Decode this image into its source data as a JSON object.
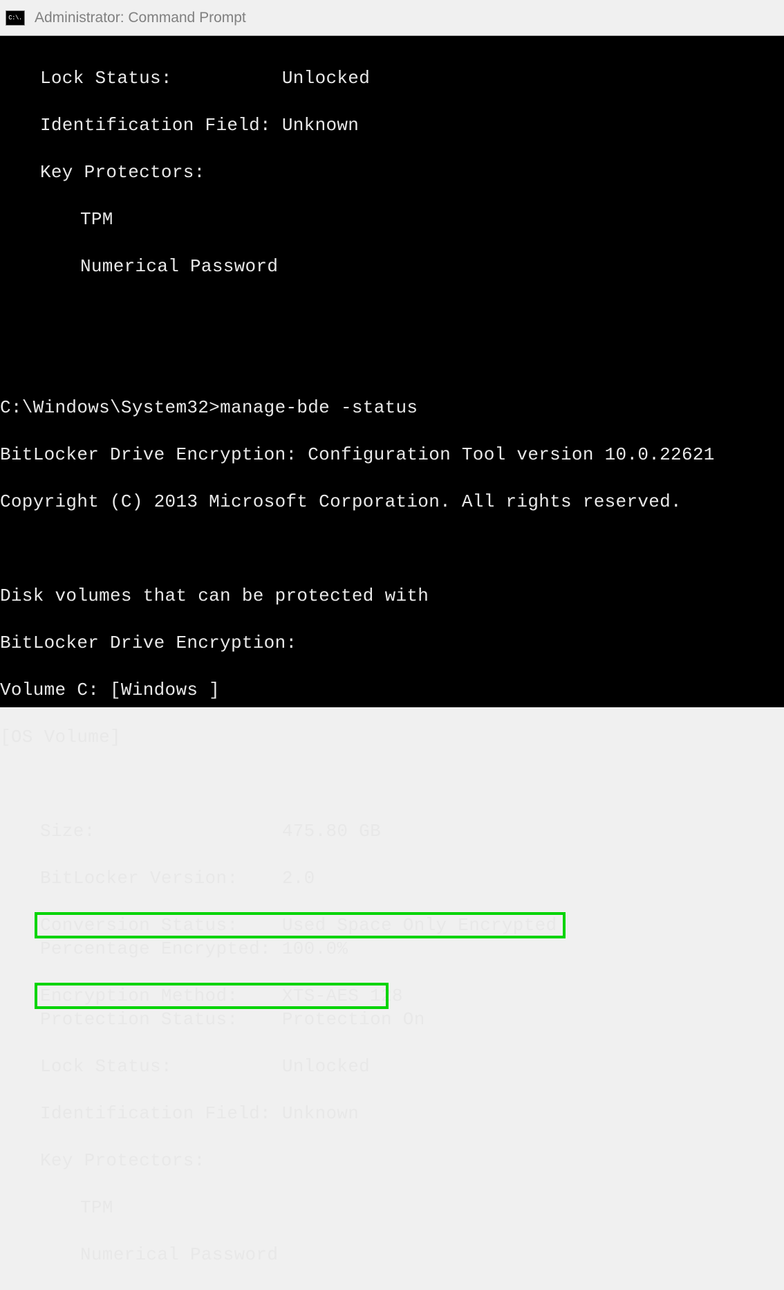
{
  "window": {
    "title": "Administrator: Command Prompt",
    "icon_label": "C:\\."
  },
  "top_block": {
    "lock_status_label": "Lock Status:",
    "lock_status_value": "Unlocked",
    "id_field_label": "Identification Field:",
    "id_field_value": "Unknown",
    "key_protectors_label": "Key Protectors:",
    "kp1": "TPM",
    "kp2": "Numerical Password"
  },
  "cmd": {
    "prompt": "C:\\Windows\\System32>",
    "command": "manage-bde -status",
    "tool_line": "BitLocker Drive Encryption: Configuration Tool version 10.0.22621",
    "copyright": "Copyright (C) 2013 Microsoft Corporation. All rights reserved."
  },
  "section": {
    "heading_l1": "Disk volumes that can be protected with",
    "heading_l2": "BitLocker Drive Encryption:",
    "volume_line": "Volume C: [Windows ]",
    "volume_type": "[OS Volume]"
  },
  "vol": {
    "size_label": "Size:                 ",
    "size_value": "475.80 GB",
    "ver_label": "BitLocker Version:    ",
    "ver_value": "2.0",
    "conv_label": "Conversion Status:    ",
    "conv_value": "Used Space Only Encrypted",
    "pct_label": "Percentage Encrypted: ",
    "pct_value": "100.0%",
    "enc_label": "Encryption Method:    ",
    "enc_value": "XTS-AES 128",
    "prot_label": "Protection Status:    ",
    "prot_value": "Protection On",
    "lock_label": "Lock Status:          ",
    "lock_value": "Unlocked",
    "id_label": "Identification Field: ",
    "id_value": "Unknown",
    "kp_label": "Key Protectors:",
    "kp1": "TPM",
    "kp2": "Numerical Password"
  },
  "highlights": [
    {
      "row": "conversion-status"
    },
    {
      "row": "encryption-method"
    }
  ]
}
